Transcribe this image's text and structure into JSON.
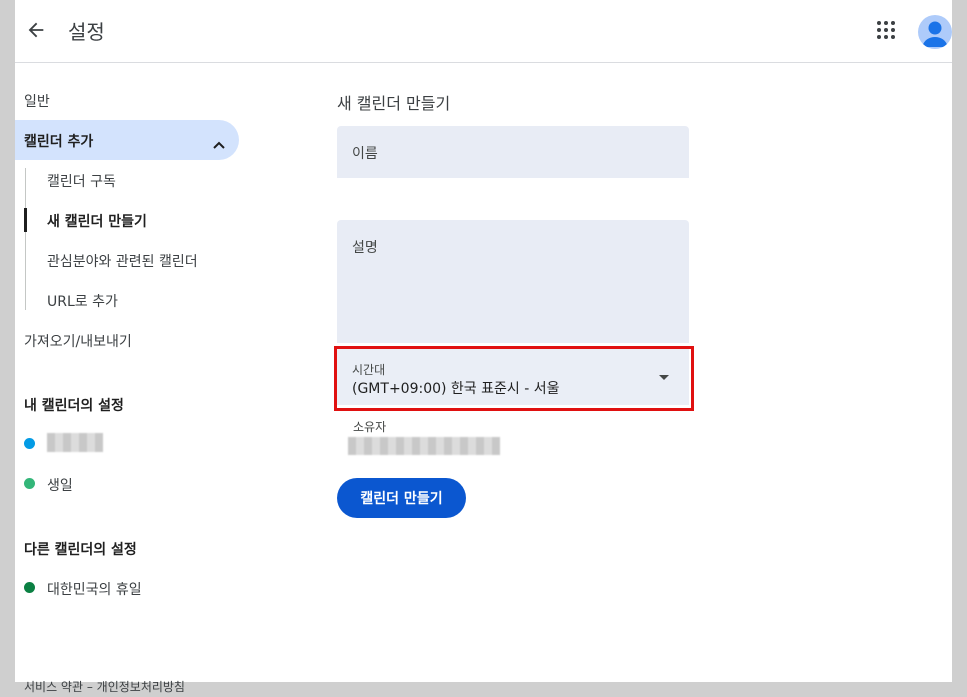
{
  "header": {
    "title": "설정",
    "back_icon": "arrow-left-icon",
    "apps_icon": "apps-grid-icon",
    "avatar_icon": "account-avatar-icon"
  },
  "sidebar": {
    "general": "일반",
    "add_calendar": "캘린더 추가",
    "sub_items": [
      "캘린더 구독",
      "새 캘린더 만들기",
      "관심분야와 관련된 캘린더",
      "URL로 추가"
    ],
    "import_export": "가져오기/내보내기",
    "my_calendars_heading": "내 캘린더의 설정",
    "my_calendars": [
      {
        "label": "",
        "color": "#039be5"
      },
      {
        "label": "생일",
        "color": "#33b679"
      }
    ],
    "other_calendars_heading": "다른 캘린더의 설정",
    "other_calendars": [
      {
        "label": "대한민국의 휴일",
        "color": "#0b8043"
      }
    ]
  },
  "form": {
    "title": "새 캘린더 만들기",
    "name_placeholder": "이름",
    "description_placeholder": "설명",
    "timezone_label": "시간대",
    "timezone_value": "(GMT+09:00) 한국 표준시 - 서울",
    "owner_label": "소유자",
    "create_button": "캘린더 만들기"
  },
  "footer": {
    "terms": "서비스 약관",
    "separator": " – ",
    "privacy": "개인정보처리방침"
  },
  "colors": {
    "accent": "#0b57d0",
    "active_nav_bg": "#d3e3fd",
    "field_bg": "#e8ecf5",
    "highlight_outline": "#e01010"
  }
}
